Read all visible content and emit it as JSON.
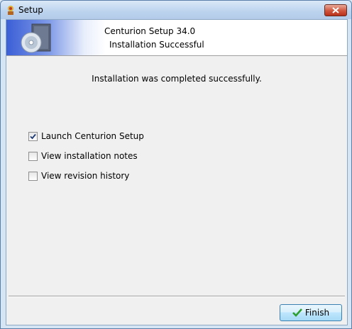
{
  "window": {
    "title": "Setup"
  },
  "banner": {
    "title": "Centurion Setup 34.0",
    "subtitle": "Installation Successful"
  },
  "message": "Installation was completed successfully.",
  "options": [
    {
      "label": "Launch Centurion Setup",
      "checked": true
    },
    {
      "label": "View installation notes",
      "checked": false
    },
    {
      "label": "View revision history",
      "checked": false
    }
  ],
  "buttons": {
    "finish": "Finish"
  },
  "icons": {
    "app": "setup-app-icon",
    "banner": "cd-install-icon",
    "close": "close-icon",
    "finish": "green-check-icon"
  },
  "colors": {
    "banner_blue": "#3b5fd6",
    "close_red": "#c8432a",
    "button_border": "#3c7fb1"
  }
}
